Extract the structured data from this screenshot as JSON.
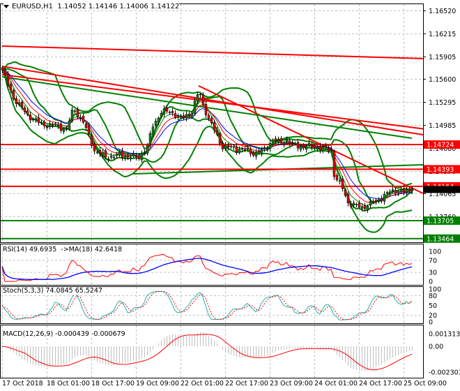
{
  "header": {
    "symbol": "EURUSD,H1",
    "ohlc": "1.14052 1.14146 1.14006 1.14122"
  },
  "colors": {
    "bull": "#1a7a1a",
    "bear": "#e00000",
    "wick": "#000000",
    "support": "#008000",
    "resistance": "#ff0000",
    "ma_fast": "#0000ff",
    "ma_mid": "#ff0000",
    "ma_slow": "#008000",
    "band": "#008000",
    "grid": "#c0c0c0",
    "rsi": "#ff0000",
    "rsi_ma": "#0000ff",
    "stoch_main": "#20b2aa",
    "stoch_signal": "#ff0000",
    "macd_hist": "#c0c0c0",
    "macd_signal": "#ff0000"
  },
  "chart_data": {
    "type": "candlestick",
    "timeframe": "H1",
    "x_tick_labels": [
      "17 Oct 2018",
      "18 Oct 01:00",
      "18 Oct 17:00",
      "19 Oct 09:00",
      "22 Oct 01:00",
      "22 Oct 17:00",
      "23 Oct 09:00",
      "24 Oct 01:00",
      "24 Oct 17:00",
      "25 Oct 09:00"
    ],
    "price_ticks": [
      "1.16520",
      "1.16215",
      "1.15905",
      "1.15600",
      "1.15295",
      "1.14985",
      "1.14680",
      "1.14370",
      "1.14065",
      "1.13760"
    ],
    "ylim": [
      1.13415,
      1.16585
    ],
    "close_anchors": [
      [
        0,
        1.15725
      ],
      [
        4,
        1.15351
      ],
      [
        9,
        1.15117
      ],
      [
        14,
        1.14996
      ],
      [
        19,
        1.14977
      ],
      [
        23,
        1.1493
      ],
      [
        25.5,
        1.15211
      ],
      [
        29,
        1.15024
      ],
      [
        33,
        1.14649
      ],
      [
        37,
        1.14556
      ],
      [
        42,
        1.14584
      ],
      [
        47,
        1.14556
      ],
      [
        49,
        1.14556
      ],
      [
        52,
        1.14696
      ],
      [
        54,
        1.14977
      ],
      [
        57,
        1.15164
      ],
      [
        60.5,
        1.15164
      ],
      [
        64,
        1.1507
      ],
      [
        68,
        1.15164
      ],
      [
        70.5,
        1.15444
      ],
      [
        72,
        1.15257
      ],
      [
        74,
        1.1507
      ],
      [
        77,
        1.14837
      ],
      [
        79,
        1.14696
      ],
      [
        83,
        1.14677
      ],
      [
        87,
        1.14649
      ],
      [
        90.5,
        1.14603
      ],
      [
        94,
        1.14649
      ],
      [
        97,
        1.1479
      ],
      [
        99,
        1.14743
      ],
      [
        102,
        1.1479
      ],
      [
        104,
        1.14715
      ],
      [
        108,
        1.14696
      ],
      [
        112,
        1.14696
      ],
      [
        115.5,
        1.14668
      ],
      [
        118,
        1.14649
      ],
      [
        119,
        1.14322
      ],
      [
        122,
        1.14135
      ],
      [
        124,
        1.13948
      ],
      [
        127,
        1.13901
      ],
      [
        129,
        1.13882
      ],
      [
        132,
        1.13929
      ],
      [
        134,
        1.13967
      ],
      [
        137,
        1.14042
      ],
      [
        139,
        1.14088
      ],
      [
        142,
        1.14116
      ],
      [
        144,
        1.14088
      ],
      [
        147,
        1.14122
      ]
    ],
    "levels": [
      {
        "price": 1.14724,
        "label": "1.14724",
        "kind": "resistance"
      },
      {
        "price": 1.14393,
        "label": "1.14393",
        "kind": "resistance"
      },
      {
        "price": 1.14164,
        "label": "1.14164",
        "kind": "resistance"
      },
      {
        "price": 1.13705,
        "label": "1.13705",
        "kind": "support"
      },
      {
        "price": 1.13464,
        "label": "1.13464",
        "kind": "support"
      }
    ],
    "trend_lines": [
      {
        "kind": "resistance",
        "from": [
          0,
          1.16043
        ],
        "to": [
          151,
          1.15875
        ]
      },
      {
        "kind": "resistance",
        "from": [
          0,
          1.15772
        ],
        "to": [
          151,
          1.14855
        ]
      },
      {
        "kind": "resistance",
        "from": [
          0,
          1.1566
        ],
        "to": [
          151,
          1.14935
        ]
      },
      {
        "kind": "resistance",
        "from": [
          70.5,
          1.1551
        ],
        "to": [
          151,
          1.1407
        ]
      },
      {
        "kind": "support",
        "from": [
          0,
          1.15631
        ],
        "to": [
          147,
          1.14808
        ]
      },
      {
        "kind": "support",
        "from": [
          47,
          1.14331
        ],
        "to": [
          151,
          1.14453
        ]
      }
    ],
    "indicators": {
      "rsi": {
        "label": "RSI(14) 49.6935  ->MA(18) 42.6418",
        "ticks": [
          "100",
          "70",
          "30",
          "0"
        ]
      },
      "stoch": {
        "label": "Stoch(5,3,3) 74.0845 65.5247",
        "ticks": [
          "100",
          "80",
          "50",
          "20",
          "0"
        ]
      },
      "macd": {
        "label": "MACD(12,26,9) -0.000439 -0.000679",
        "ticks": [
          "0.001313",
          "0.00",
          "-0.002303"
        ]
      }
    }
  }
}
